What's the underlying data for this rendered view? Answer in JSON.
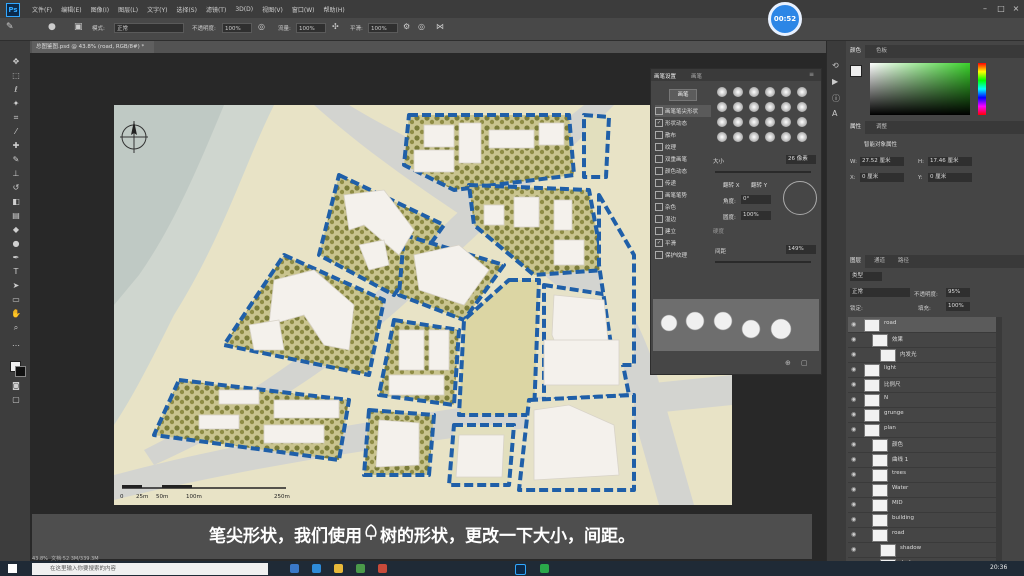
{
  "menubar": {
    "app_icon": "Ps",
    "menus": [
      "文件(F)",
      "编辑(E)",
      "图像(I)",
      "图层(L)",
      "文字(Y)",
      "选择(S)",
      "滤镜(T)",
      "3D(D)",
      "视图(V)",
      "窗口(W)",
      "帮助(H)"
    ]
  },
  "optionsbar": {
    "mode_label": "模式:",
    "mode_value": "正常",
    "opacity_label": "不透明度:",
    "opacity_value": "100%",
    "flow_label": "流量:",
    "flow_value": "100%",
    "smooth_label": "平滑:",
    "smooth_value": "100%"
  },
  "clock": {
    "time": "00:52"
  },
  "document": {
    "tab_title": "总图鉴图.psd @ 43.8% (road, RGB/8#) *"
  },
  "canvas": {
    "scale_labels": [
      "0",
      "25m",
      "50m",
      "100m",
      "250m"
    ]
  },
  "brush_panel": {
    "tabs": [
      "画笔设置",
      "画笔"
    ],
    "presets_button": "画笔",
    "options": [
      {
        "label": "画笔笔尖形状",
        "checked": false
      },
      {
        "label": "形状动态",
        "checked": true
      },
      {
        "label": "散布",
        "checked": false
      },
      {
        "label": "纹理",
        "checked": false
      },
      {
        "label": "双重画笔",
        "checked": false
      },
      {
        "label": "颜色动态",
        "checked": false
      },
      {
        "label": "传递",
        "checked": false
      },
      {
        "label": "画笔笔势",
        "checked": false
      },
      {
        "label": "杂色",
        "checked": false
      },
      {
        "label": "湿边",
        "checked": false
      },
      {
        "label": "建立",
        "checked": false
      },
      {
        "label": "平滑",
        "checked": true
      },
      {
        "label": "保护纹理",
        "checked": false
      }
    ],
    "size_label": "大小",
    "size_value": "26 像素",
    "flip_x": "翻转 X",
    "flip_y": "翻转 Y",
    "angle_label": "角度:",
    "angle_value": "0°",
    "roundness_label": "圆度:",
    "roundness_value": "100%",
    "hardness_label": "硬度",
    "spacing_label": "间距",
    "spacing_value": "149%"
  },
  "right_panel": {
    "color_tabs": [
      "颜色",
      "色板"
    ],
    "props_tabs": [
      "属性",
      "调整"
    ],
    "props_title": "智能对象属性",
    "w_label": "W:",
    "w_value": "27.52 厘米",
    "h_label": "H:",
    "h_value": "17.46 厘米",
    "x_label": "X:",
    "x_value": "0 厘米",
    "y_label": "Y:",
    "y_value": "0 厘米",
    "layers_tabs": [
      "图层",
      "通道",
      "路径"
    ],
    "kind_label": "类型",
    "blend_value": "正常",
    "opacity_label": "不透明度:",
    "opacity_value": "95%",
    "lock_label": "锁定:",
    "fill_label": "填充:",
    "fill_value": "100%",
    "layers": [
      {
        "name": "road",
        "indent": 0
      },
      {
        "name": "效果",
        "indent": 1
      },
      {
        "name": "内发光",
        "indent": 2
      },
      {
        "name": "light",
        "indent": 0
      },
      {
        "name": "比例尺",
        "indent": 0
      },
      {
        "name": "N",
        "indent": 0
      },
      {
        "name": "grunge",
        "indent": 0
      },
      {
        "name": "plan",
        "indent": 0
      },
      {
        "name": "颜色",
        "indent": 1
      },
      {
        "name": "曲线 1",
        "indent": 1
      },
      {
        "name": "trees",
        "indent": 1
      },
      {
        "name": "Water",
        "indent": 1
      },
      {
        "name": "MID",
        "indent": 1
      },
      {
        "name": "building",
        "indent": 1
      },
      {
        "name": "road",
        "indent": 1
      },
      {
        "name": "shadow",
        "indent": 2
      },
      {
        "name": "dark",
        "indent": 2
      }
    ]
  },
  "subtitle": {
    "text_before": "笔尖形状，我们使用",
    "text_after": "树的形状，更改一下大小，间距。"
  },
  "status": {
    "zoom": "43.8%",
    "doc": "文档:52.3M/339.3M"
  },
  "taskbar": {
    "search_placeholder": "在这里输入你要搜索的内容",
    "time": "20:36"
  },
  "colors": {
    "accent": "#31a8ff",
    "road_dash": "#1f5fa8",
    "clock": "#2c86e6",
    "land": "#e3ddb8",
    "green": "#7b7d3a"
  }
}
